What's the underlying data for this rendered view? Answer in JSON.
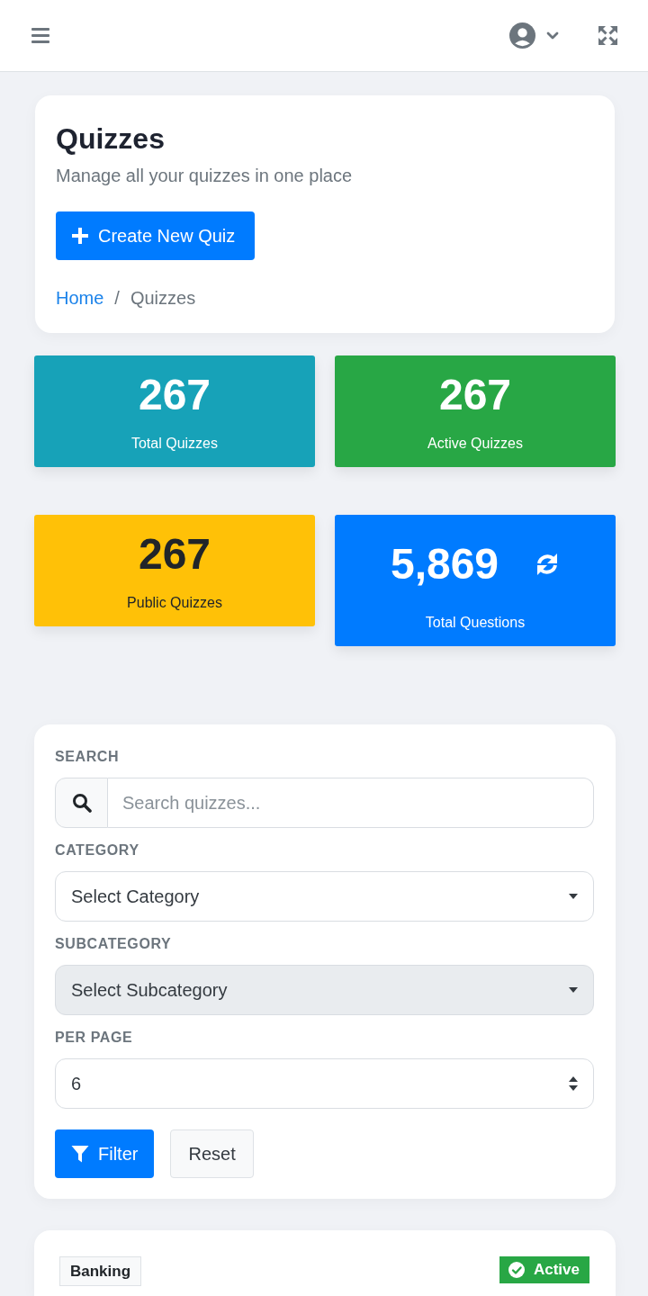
{
  "header": {
    "title": "Quizzes",
    "subtitle": "Manage all your quizzes in one place",
    "action": "Create New Quiz",
    "breadcrumb": {
      "separator": "/",
      "items": [
        {
          "label": "Home",
          "current": false
        },
        {
          "label": "Quizzes",
          "current": true
        }
      ]
    }
  },
  "stats": [
    {
      "value": "267",
      "label": "Total Quizzes",
      "color": "#17a2b8",
      "refreshable": false
    },
    {
      "value": "267",
      "label": "Active Quizzes",
      "color": "#28a745",
      "refreshable": false
    },
    {
      "value": "267",
      "label": "Public Quizzes",
      "color": "#ffc107",
      "refreshable": false
    },
    {
      "value": "5,869",
      "label": "Total Questions",
      "color": "#007bff",
      "refreshable": true
    }
  ],
  "filters": {
    "fields": [
      {
        "kind": "search",
        "label": "SEARCH",
        "placeholder": "Search quizzes...",
        "disabled": false
      },
      {
        "kind": "dropdown",
        "label": "CATEGORY",
        "value": "Select Category",
        "disabled": false
      },
      {
        "kind": "dropdown",
        "label": "SUBCATEGORY",
        "value": "Select Subcategory",
        "disabled": true
      },
      {
        "kind": "select",
        "label": "PER PAGE",
        "value": "6",
        "disabled": false
      }
    ],
    "buttons": [
      {
        "label": "Filter",
        "kind": "primary"
      },
      {
        "label": "Reset",
        "kind": "secondary"
      }
    ]
  },
  "quizzes": [
    {
      "category": "Banking",
      "status": "Active",
      "active": true
    }
  ]
}
